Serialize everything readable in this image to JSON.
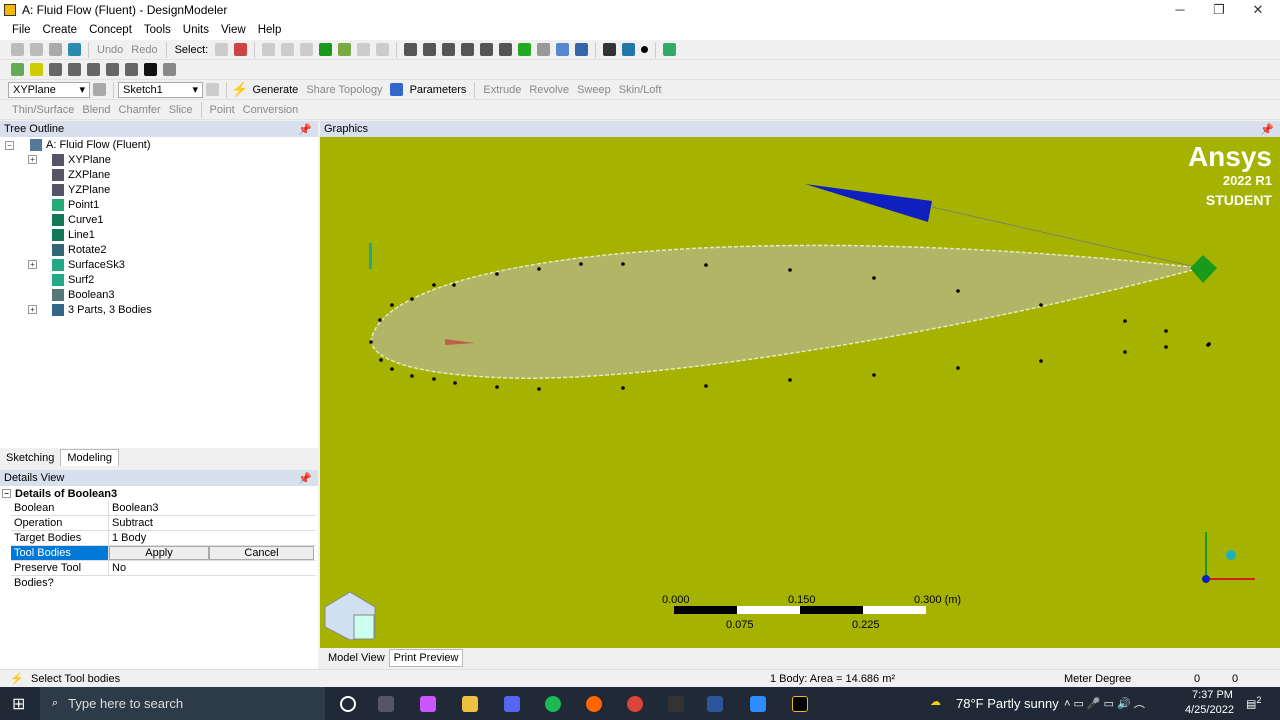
{
  "window": {
    "title": "A: Fluid Flow (Fluent) - DesignModeler",
    "minimize": "─",
    "maximize": "❐",
    "close": "✕"
  },
  "menu": [
    "File",
    "Create",
    "Concept",
    "Tools",
    "Units",
    "View",
    "Help"
  ],
  "toolbar1": {
    "undo": "Undo",
    "redo": "Redo",
    "select": "Select:"
  },
  "toolbar3": {
    "plane": "XYPlane",
    "sketch": "Sketch1",
    "generate": "Generate",
    "share_topology": "Share Topology",
    "parameters": "Parameters",
    "extrude": "Extrude",
    "revolve": "Revolve",
    "sweep": "Sweep",
    "skin_loft": "Skin/Loft"
  },
  "toolbar4": {
    "thin_surface": "Thin/Surface",
    "blend": "Blend",
    "chamfer": "Chamfer",
    "slice": "Slice",
    "point": "Point",
    "conversion": "Conversion"
  },
  "tree": {
    "header": "Tree Outline",
    "root": "A: Fluid Flow (Fluent)",
    "items": [
      "XYPlane",
      "ZXPlane",
      "YZPlane",
      "Point1",
      "Curve1",
      "Line1",
      "Rotate2",
      "SurfaceSk3",
      "Surf2",
      "Boolean3",
      "3 Parts, 3 Bodies"
    ]
  },
  "tabs": {
    "sketching": "Sketching",
    "modeling": "Modeling"
  },
  "details": {
    "header": "Details View",
    "title": "Details of Boolean3",
    "rows": [
      {
        "k": "Boolean",
        "v": "Boolean3"
      },
      {
        "k": "Operation",
        "v": "Subtract"
      },
      {
        "k": "Target Bodies",
        "v": "1 Body"
      }
    ],
    "tool_bodies": "Tool Bodies",
    "apply": "Apply",
    "cancel": "Cancel",
    "preserve_k": "Preserve Tool Bodies?",
    "preserve_v": "No"
  },
  "graphics": {
    "header": "Graphics",
    "brand": "Ansys",
    "version": "2022 R1",
    "edition": "STUDENT",
    "scale_top": [
      "0.000",
      "0.150",
      "0.300 (m)"
    ],
    "scale_bottom": [
      "0.075",
      "0.225"
    ],
    "bg": "#a5b300"
  },
  "view_tabs": {
    "model_view": "Model View",
    "print_preview": "Print Preview"
  },
  "status": {
    "left": "Select Tool bodies",
    "area": "1 Body: Area = 14.686 m²",
    "units": "Meter  Degree",
    "v1": "0",
    "v2": "0"
  },
  "taskbar": {
    "search": "Type here to search",
    "weather": "78°F  Partly sunny",
    "time": "7:37 PM",
    "date": "4/25/2022",
    "notif": "2"
  }
}
